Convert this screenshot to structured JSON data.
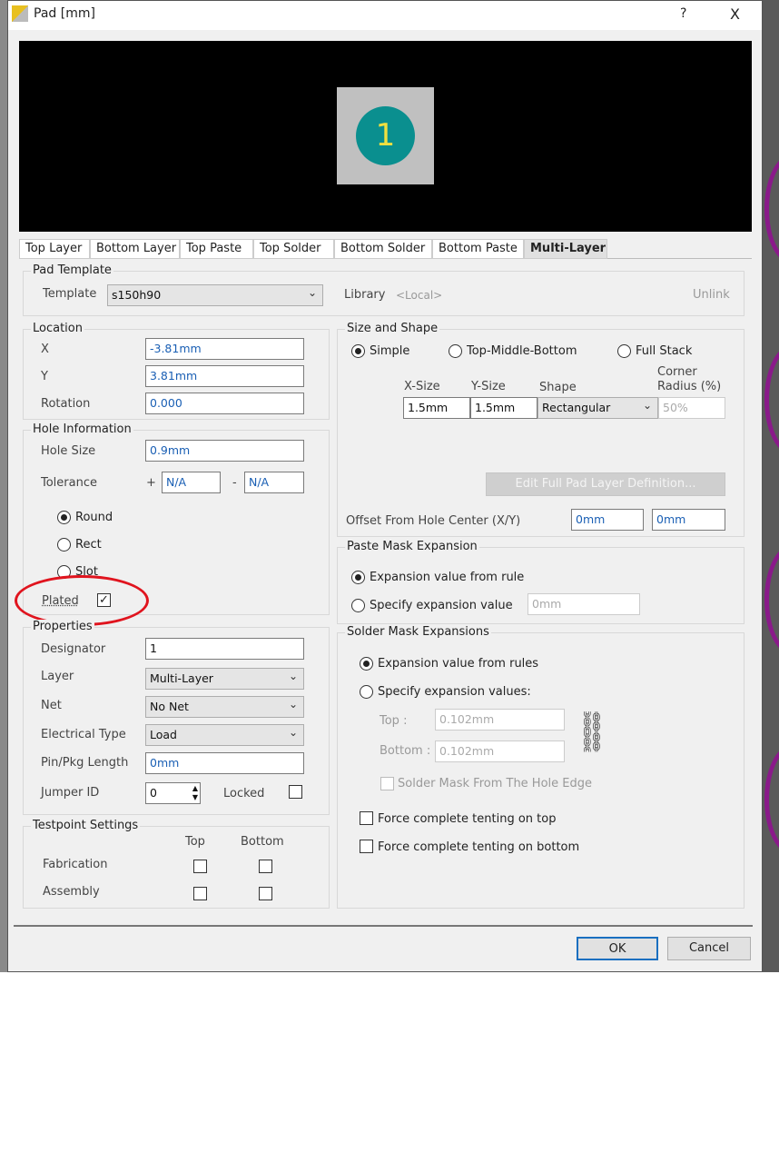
{
  "window": {
    "title": "Pad [mm]",
    "help": "?",
    "close": "X"
  },
  "preview": {
    "pad_number": "1"
  },
  "tabs": [
    "Top Layer",
    "Bottom Layer",
    "Top Paste",
    "Top Solder",
    "Bottom Solder",
    "Bottom Paste",
    "Multi-Layer"
  ],
  "active_tab": "Multi-Layer",
  "pad_template": {
    "title": "Pad Template",
    "template_label": "Template",
    "template_value": "s150h90",
    "library_label": "Library",
    "library_value": "<Local>",
    "unlink": "Unlink"
  },
  "location": {
    "title": "Location",
    "x_label": "X",
    "x": "-3.81mm",
    "y_label": "Y",
    "y": "3.81mm",
    "rotation_label": "Rotation",
    "rotation": "0.000"
  },
  "hole": {
    "title": "Hole Information",
    "size_label": "Hole Size",
    "size": "0.9mm",
    "tolerance_label": "Tolerance",
    "plus": "+",
    "tol_plus": "N/A",
    "minus": "-",
    "tol_minus": "N/A",
    "round": "Round",
    "rect": "Rect",
    "slot": "Slot",
    "selected": "Round",
    "plated_label": "Plated",
    "plated": true
  },
  "properties": {
    "title": "Properties",
    "designator_label": "Designator",
    "designator": "1",
    "layer_label": "Layer",
    "layer": "Multi-Layer",
    "net_label": "Net",
    "net": "No Net",
    "etype_label": "Electrical Type",
    "etype": "Load",
    "pin_label": "Pin/Pkg Length",
    "pin": "0mm",
    "jumper_label": "Jumper ID",
    "jumper": "0",
    "locked_label": "Locked",
    "locked": false
  },
  "testpoint": {
    "title": "Testpoint Settings",
    "top": "Top",
    "bottom": "Bottom",
    "fabrication": "Fabrication",
    "assembly": "Assembly"
  },
  "size_shape": {
    "title": "Size and Shape",
    "simple": "Simple",
    "tmb": "Top-Middle-Bottom",
    "full": "Full Stack",
    "selected": "Simple",
    "xsize_label": "X-Size",
    "ysize_label": "Y-Size",
    "shape_label": "Shape",
    "corner_label1": "Corner",
    "corner_label2": "Radius (%)",
    "xsize": "1.5mm",
    "ysize": "1.5mm",
    "shape": "Rectangular",
    "corner": "50%",
    "edit_button": "Edit Full Pad Layer Definition...",
    "offset_label": "Offset From Hole Center (X/Y)",
    "offset_x": "0mm",
    "offset_y": "0mm"
  },
  "paste": {
    "title": "Paste Mask Expansion",
    "from_rule": "Expansion value from rule",
    "specify": "Specify expansion value",
    "value": "0mm"
  },
  "solder": {
    "title": "Solder Mask Expansions",
    "from_rules": "Expansion value from rules",
    "specify": "Specify expansion values:",
    "top_label": "Top :",
    "top": "0.102mm",
    "bottom_label": "Bottom :",
    "bottom": "0.102mm",
    "hole_edge": "Solder Mask From The Hole Edge",
    "tent_top": "Force complete tenting on top",
    "tent_bottom": "Force complete tenting on bottom"
  },
  "buttons": {
    "ok": "OK",
    "cancel": "Cancel"
  },
  "colors": {
    "pad": "#0a8f8f",
    "annotation": "#e0141e"
  }
}
